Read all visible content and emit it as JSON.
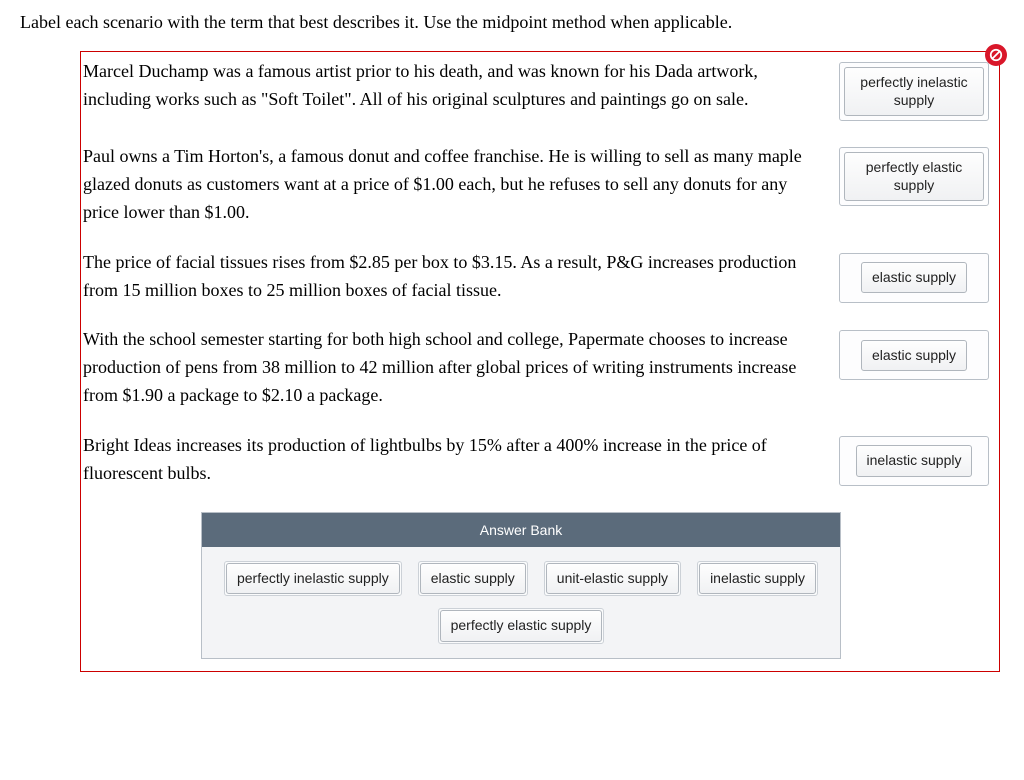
{
  "instruction": "Label each scenario with the term that best describes it. Use the midpoint method when applicable.",
  "scenarios": [
    {
      "text": "Marcel Duchamp was a famous artist prior to his death, and was known for his Dada artwork, including works such as \"Soft Toilet\". All of his original sculptures and paintings go on sale.",
      "answer": "perfectly inelastic supply"
    },
    {
      "text": "Paul owns a Tim Horton's, a famous donut and coffee franchise. He is willing to sell as many maple glazed donuts as customers want at a price of $1.00 each, but he refuses to sell any donuts for any price lower than $1.00.",
      "answer": "perfectly elastic supply"
    },
    {
      "text": "The price of facial tissues rises from $2.85 per box to $3.15. As a result, P&G increases production from 15 million boxes to 25 million boxes of facial tissue.",
      "answer": "elastic supply"
    },
    {
      "text": "With the school semester starting for both high school and college, Papermate chooses to increase production of pens from 38 million to 42 million after global prices of writing instruments increase from $1.90 a package to $2.10 a package.",
      "answer": "elastic supply"
    },
    {
      "text": "Bright Ideas increases its production of lightbulbs by 15% after a 400% increase in the price of fluorescent bulbs.",
      "answer": "inelastic supply"
    }
  ],
  "answer_bank": {
    "title": "Answer Bank",
    "options": [
      "perfectly inelastic supply",
      "elastic supply",
      "unit-elastic supply",
      "inelastic supply",
      "perfectly elastic supply"
    ]
  }
}
